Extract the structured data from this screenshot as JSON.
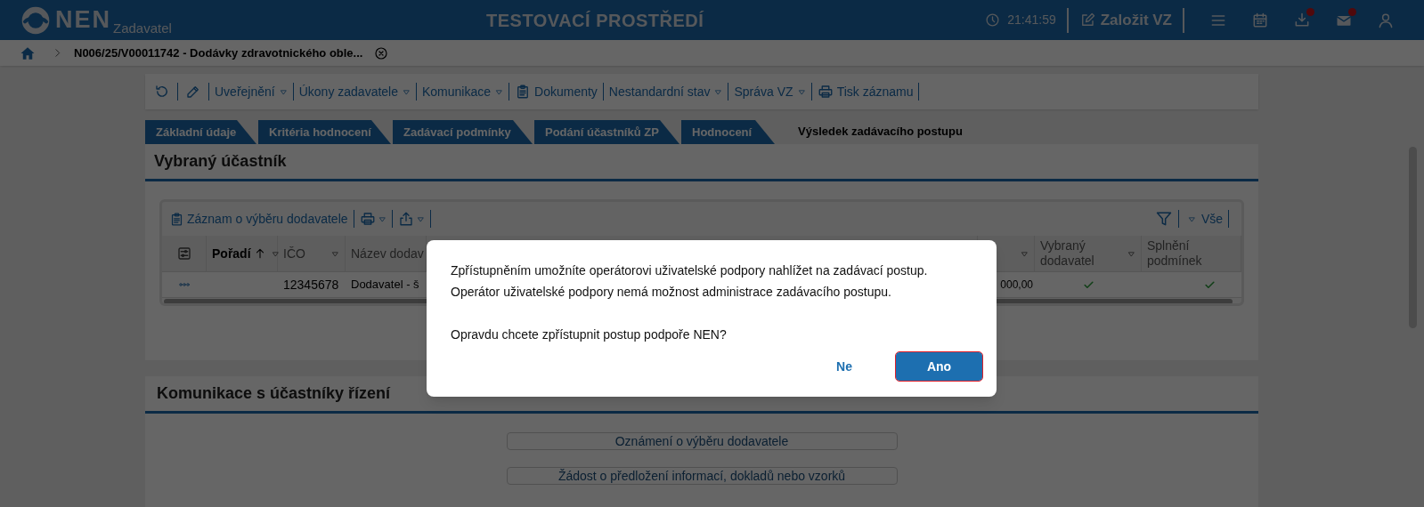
{
  "header": {
    "logo": "NEN",
    "logo_subtitle": "Zadavatel",
    "title": "TESTOVACÍ PROSTŘEDÍ",
    "time": "21:41:59",
    "create_button": "Založit VZ",
    "icons": [
      {
        "kind": "menu",
        "notification": false
      },
      {
        "kind": "calendar",
        "notification": false
      },
      {
        "kind": "download",
        "notification": true
      },
      {
        "kind": "mail",
        "notification": true
      },
      {
        "kind": "user",
        "notification": false
      }
    ]
  },
  "breadcrumb": {
    "current": "N006/25/V00011742 - Dodávky zdravotnického oble..."
  },
  "toolbar": [
    {
      "kind": "refresh"
    },
    {
      "kind": "edit"
    },
    {
      "kind": "dropdown",
      "label": "Uveřejnění"
    },
    {
      "kind": "dropdown",
      "label": "Úkony zadavatele"
    },
    {
      "kind": "dropdown",
      "label": "Komunikace"
    },
    {
      "kind": "clipboard",
      "label": "Dokumenty"
    },
    {
      "kind": "dropdown",
      "label": "Nestandardní stav"
    },
    {
      "kind": "dropdown",
      "label": "Správa VZ"
    },
    {
      "kind": "print",
      "label": "Tisk záznamu"
    }
  ],
  "tabs": [
    {
      "label": "Základní údaje",
      "selected": false
    },
    {
      "label": "Kritéria hodnocení",
      "selected": false
    },
    {
      "label": "Zadávací podmínky",
      "selected": false
    },
    {
      "label": "Podání účastníků ZP",
      "selected": false
    },
    {
      "label": "Hodnocení",
      "selected": false
    },
    {
      "label": "Výsledek zadávacího postupu",
      "selected": true
    }
  ],
  "selected_participant": {
    "title": "Vybraný účastník",
    "table_toolbar": {
      "record_button": "Záznam o výběru dodavatele",
      "filter_label": "Vše"
    },
    "table": {
      "columns": [
        {
          "label": "Pořadí",
          "sorted_ascending": true,
          "filter": true
        },
        {
          "label": "IČO",
          "filter": true
        },
        {
          "label": "Název dodav",
          "filter": false
        },
        {
          "filter": true
        },
        {
          "label": "Vybraný dodavatel",
          "filter": true
        },
        {
          "label": "Splnění podmínek",
          "filter": false
        }
      ],
      "rows": [
        {
          "cells": [
            "",
            "12345678",
            "Dodavatel - š",
            "000,00"
          ],
          "selected_supplier": true,
          "conditions_met": true
        }
      ]
    }
  },
  "communication": {
    "title": "Komunikace s účastníky řízení",
    "buttons": [
      "Oznámení o výběru dodavatele",
      "Žádost o předložení informací, dokladů nebo vzorků"
    ]
  },
  "dialog": {
    "paragraphs": [
      "Zpřístupněním umožníte operátorovi uživatelské podpory nahlížet na zadávací postup. Operátor uživatelské podpory nemá možnost administrace zadávacího postupu.",
      "Opravdu chcete zpřístupnit postup podpoře NEN?"
    ],
    "buttons": [
      {
        "label": "Ne",
        "kind": "secondary",
        "focused": false
      },
      {
        "label": "Ano",
        "kind": "primary",
        "focused": true
      }
    ]
  }
}
